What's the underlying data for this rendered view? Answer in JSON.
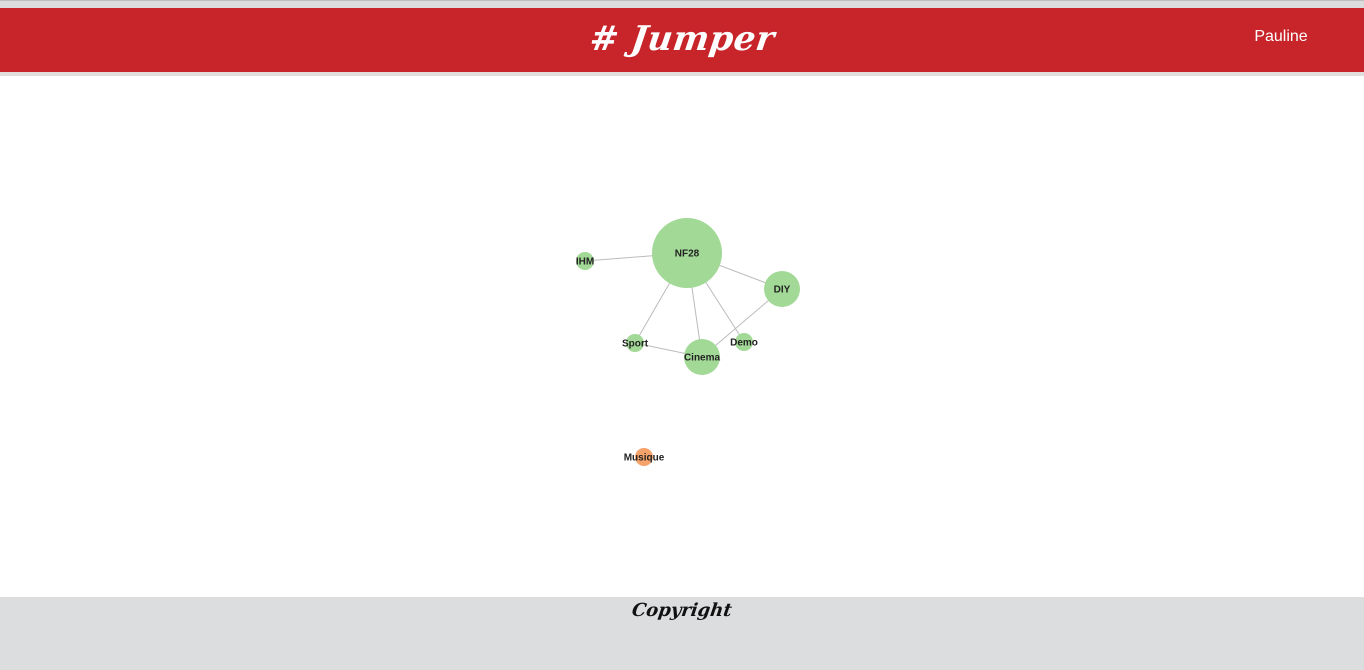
{
  "header": {
    "logo_text": "# Jumper",
    "user_name": "Pauline",
    "color": "#c8252b"
  },
  "graph": {
    "nodes": [
      {
        "id": "NF28",
        "label": "NF28",
        "weight": 35,
        "color": "#a2d996"
      },
      {
        "id": "IHM",
        "label": "IHM",
        "weight": 9,
        "color": "#a2d996"
      },
      {
        "id": "DIY",
        "label": "DIY",
        "weight": 18,
        "color": "#a2d996"
      },
      {
        "id": "Sport",
        "label": "Sport",
        "weight": 9,
        "color": "#a2d996"
      },
      {
        "id": "Demo",
        "label": "Demo",
        "weight": 9,
        "color": "#a2d996"
      },
      {
        "id": "Cinema",
        "label": "Cinema",
        "weight": 18,
        "color": "#a2d996"
      },
      {
        "id": "Musique",
        "label": "Musique",
        "weight": 9,
        "color": "#f5a36a"
      }
    ],
    "links": [
      {
        "source": "NF28",
        "target": "IHM"
      },
      {
        "source": "NF28",
        "target": "DIY"
      },
      {
        "source": "NF28",
        "target": "Sport"
      },
      {
        "source": "NF28",
        "target": "Cinema"
      },
      {
        "source": "NF28",
        "target": "Demo"
      },
      {
        "source": "DIY",
        "target": "Cinema"
      },
      {
        "source": "Sport",
        "target": "Cinema"
      }
    ]
  },
  "footer": {
    "copyright": "Copyright",
    "color": "#dcdddf"
  }
}
